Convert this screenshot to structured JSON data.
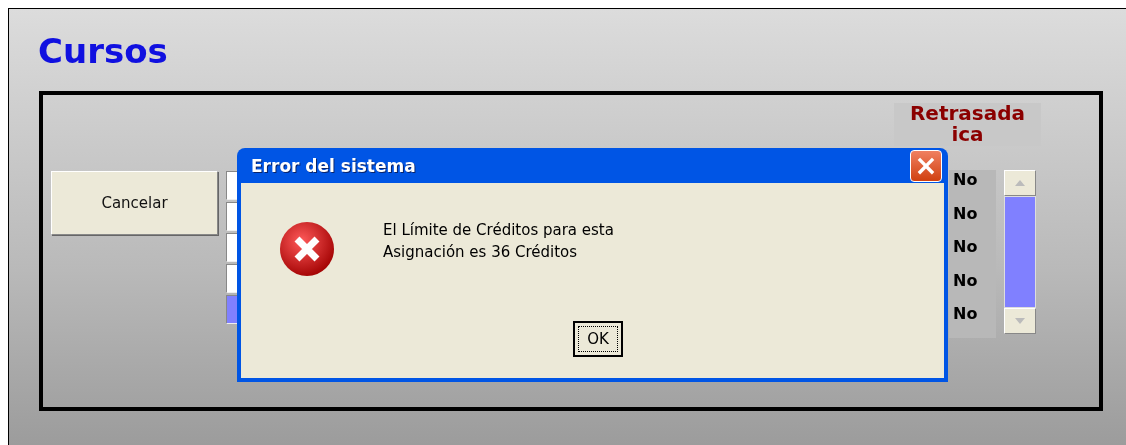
{
  "form": {
    "title": "Cursos",
    "cancel_button": "Cancelar",
    "fields": [
      {
        "selected": false
      },
      {
        "selected": false
      },
      {
        "selected": false
      },
      {
        "selected": false
      },
      {
        "selected": true
      }
    ],
    "column_header": [
      "Retrasada",
      "ica"
    ],
    "column_values": [
      "No",
      "No",
      "No",
      "No",
      "No"
    ]
  },
  "dialog": {
    "title": "Error del sistema",
    "close": "×",
    "message": [
      "El Límite de Créditos para esta",
      "Asignación es 36 Créditos"
    ],
    "button": "OK"
  }
}
